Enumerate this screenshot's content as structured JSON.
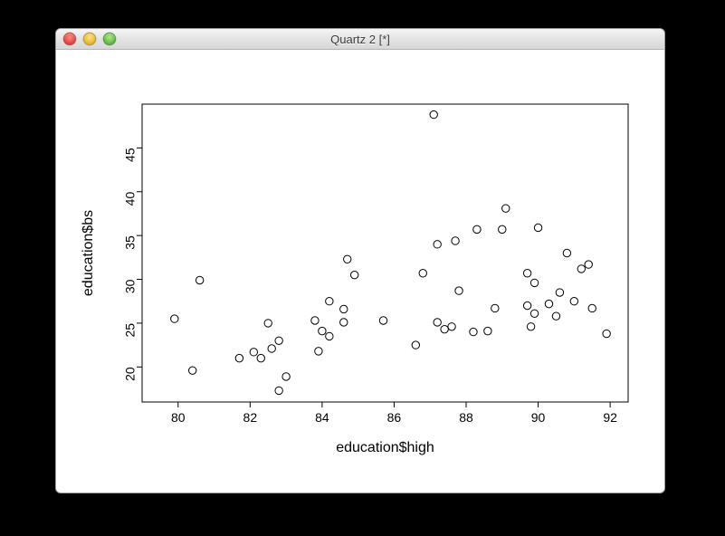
{
  "window": {
    "title": "Quartz 2 [*]"
  },
  "chart_data": {
    "type": "scatter",
    "xlabel": "education$high",
    "ylabel": "education$bs",
    "xlim": [
      79,
      92.5
    ],
    "ylim": [
      16,
      50
    ],
    "x_ticks": [
      80,
      82,
      84,
      86,
      88,
      90,
      92
    ],
    "y_ticks": [
      20,
      25,
      30,
      35,
      40,
      45
    ],
    "grid": false,
    "points": [
      {
        "x": 79.9,
        "y": 25.5
      },
      {
        "x": 80.4,
        "y": 19.6
      },
      {
        "x": 80.6,
        "y": 29.9
      },
      {
        "x": 81.7,
        "y": 21.0
      },
      {
        "x": 82.1,
        "y": 21.7
      },
      {
        "x": 82.3,
        "y": 21.0
      },
      {
        "x": 82.5,
        "y": 25.0
      },
      {
        "x": 82.6,
        "y": 22.1
      },
      {
        "x": 82.8,
        "y": 23.0
      },
      {
        "x": 82.8,
        "y": 17.3
      },
      {
        "x": 83.0,
        "y": 18.9
      },
      {
        "x": 83.8,
        "y": 25.3
      },
      {
        "x": 83.9,
        "y": 21.8
      },
      {
        "x": 84.0,
        "y": 24.1
      },
      {
        "x": 84.2,
        "y": 23.5
      },
      {
        "x": 84.2,
        "y": 27.5
      },
      {
        "x": 84.6,
        "y": 26.6
      },
      {
        "x": 84.6,
        "y": 25.1
      },
      {
        "x": 84.7,
        "y": 32.3
      },
      {
        "x": 84.9,
        "y": 30.5
      },
      {
        "x": 85.7,
        "y": 25.3
      },
      {
        "x": 86.6,
        "y": 22.5
      },
      {
        "x": 86.8,
        "y": 30.7
      },
      {
        "x": 87.1,
        "y": 48.8
      },
      {
        "x": 87.2,
        "y": 25.1
      },
      {
        "x": 87.2,
        "y": 34.0
      },
      {
        "x": 87.4,
        "y": 24.3
      },
      {
        "x": 87.6,
        "y": 24.6
      },
      {
        "x": 87.7,
        "y": 34.4
      },
      {
        "x": 87.8,
        "y": 28.7
      },
      {
        "x": 88.2,
        "y": 24.0
      },
      {
        "x": 88.3,
        "y": 35.7
      },
      {
        "x": 88.6,
        "y": 24.1
      },
      {
        "x": 88.8,
        "y": 26.7
      },
      {
        "x": 89.0,
        "y": 35.7
      },
      {
        "x": 89.1,
        "y": 38.1
      },
      {
        "x": 89.7,
        "y": 27.0
      },
      {
        "x": 89.7,
        "y": 30.7
      },
      {
        "x": 89.8,
        "y": 24.6
      },
      {
        "x": 89.9,
        "y": 26.1
      },
      {
        "x": 89.9,
        "y": 29.6
      },
      {
        "x": 90.0,
        "y": 35.9
      },
      {
        "x": 90.3,
        "y": 27.2
      },
      {
        "x": 90.5,
        "y": 25.8
      },
      {
        "x": 90.6,
        "y": 28.5
      },
      {
        "x": 90.8,
        "y": 33.0
      },
      {
        "x": 91.0,
        "y": 27.5
      },
      {
        "x": 91.2,
        "y": 31.2
      },
      {
        "x": 91.4,
        "y": 31.7
      },
      {
        "x": 91.5,
        "y": 26.7
      },
      {
        "x": 91.9,
        "y": 23.8
      }
    ]
  }
}
